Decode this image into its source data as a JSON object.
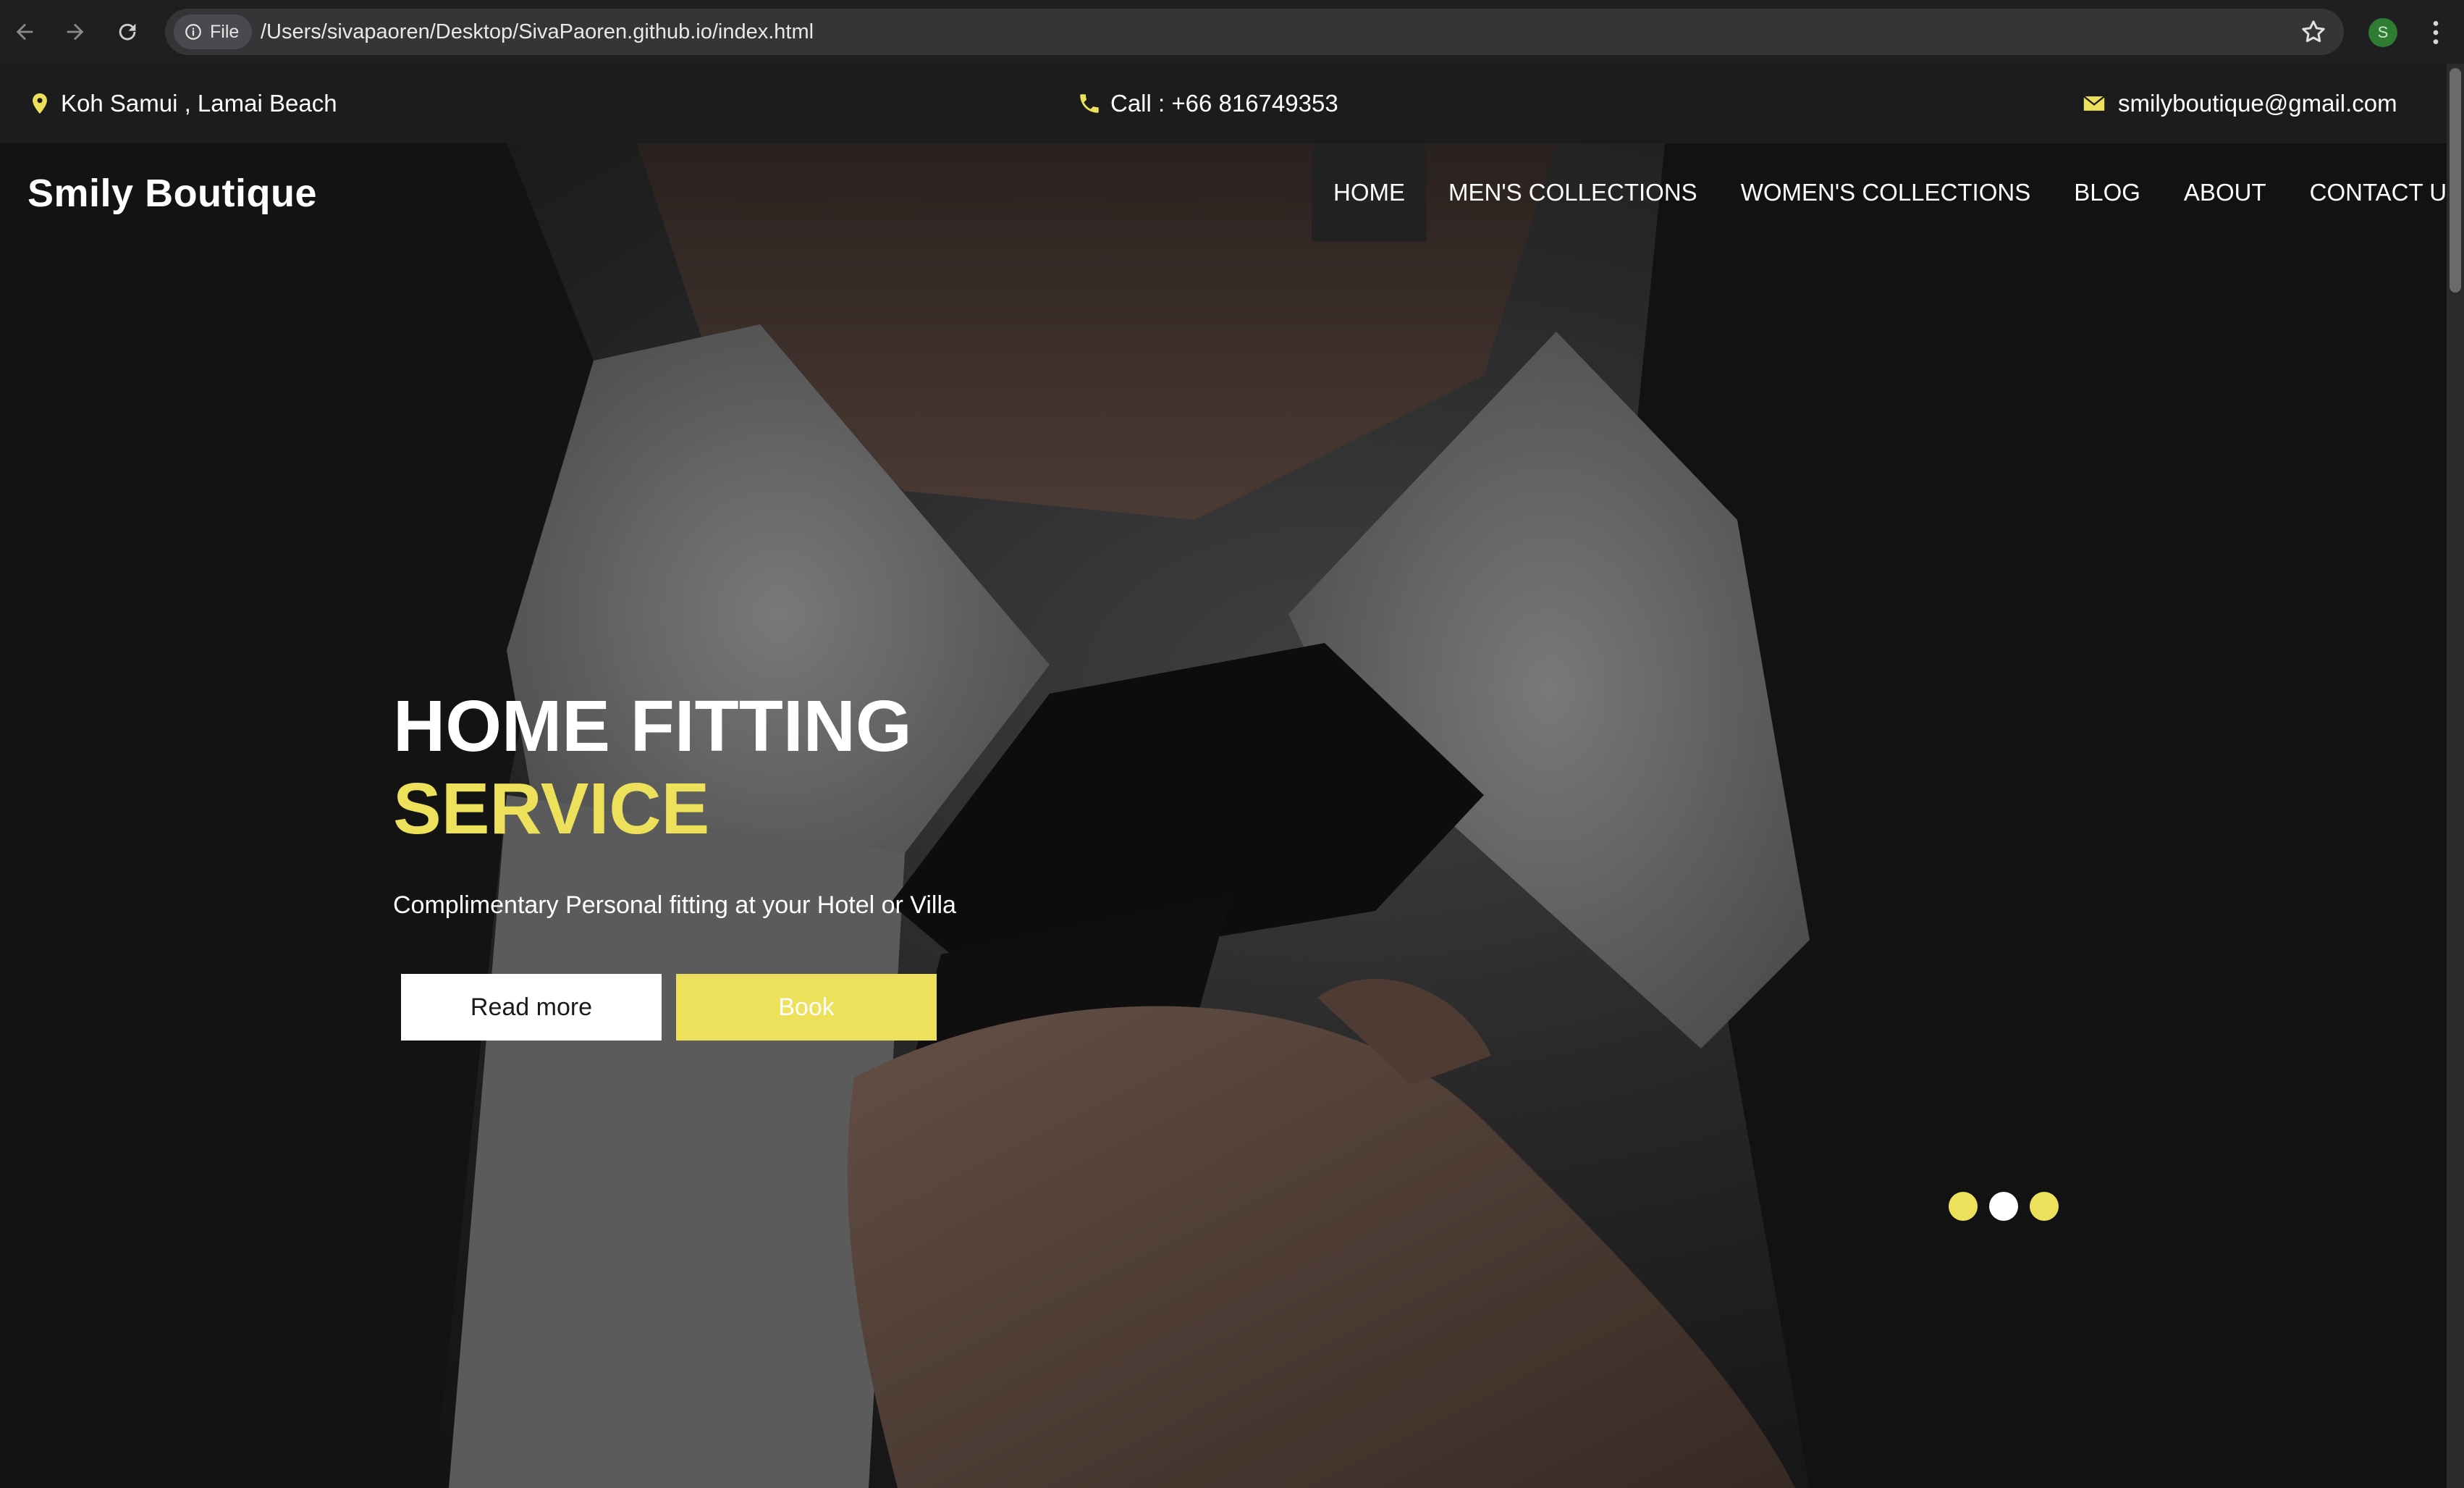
{
  "browser": {
    "file_chip_label": "File",
    "url": "/Users/sivapaoren/Desktop/SivaPaoren.github.io/index.html",
    "profile_initial": "S"
  },
  "info_bar": {
    "location": "Koh Samui , Lamai Beach",
    "phone": "Call : +66 816749353",
    "email": "smilyboutique@gmail.com"
  },
  "header": {
    "brand": "Smily Boutique",
    "nav": [
      {
        "label": "HOME",
        "active": true
      },
      {
        "label": "MEN'S COLLECTIONS"
      },
      {
        "label": "WOMEN'S COLLECTIONS"
      },
      {
        "label": "BLOG"
      },
      {
        "label": "ABOUT"
      },
      {
        "label": "CONTACT US"
      }
    ]
  },
  "hero": {
    "title_line1": "HOME FITTING",
    "title_line2": "SERVICE",
    "subtitle": "Complimentary Personal fitting at your Hotel or Villa",
    "read_more_label": "Read more",
    "book_label": "Book",
    "slide_count": 3,
    "active_slide": 2
  },
  "colors": {
    "accent": "#ede05a",
    "bar_bg": "#1c1c1c",
    "text": "#ffffff"
  }
}
